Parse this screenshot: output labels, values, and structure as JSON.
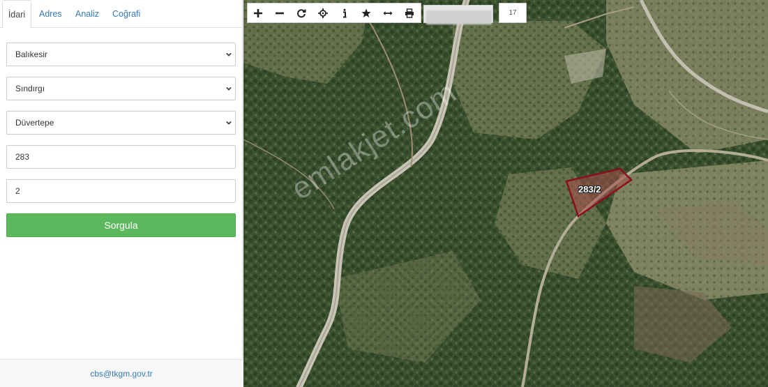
{
  "tabs": [
    {
      "label": "İdari"
    },
    {
      "label": "Adres"
    },
    {
      "label": "Analiz"
    },
    {
      "label": "Coğrafi"
    }
  ],
  "form": {
    "il": "Balıkesir",
    "ilce": "Sındırgı",
    "mahalle": "Düvertepe",
    "ada": "283",
    "parsel": "2",
    "submit_label": "Sorgula"
  },
  "footer": {
    "email": "cbs@tkgm.gov.tr"
  },
  "toolbar": {
    "buttons": [
      "plus-icon",
      "minus-icon",
      "refresh-icon",
      "locate-icon",
      "info-icon",
      "star-icon",
      "measure-icon",
      "print-icon"
    ],
    "zoom_level": "17"
  },
  "map": {
    "parcel_label": "283/2",
    "watermark": "emlakjet.com",
    "parcel_color": "#8b0f1e"
  },
  "colors": {
    "accent": "#337ab7",
    "button": "#5cb85c"
  }
}
